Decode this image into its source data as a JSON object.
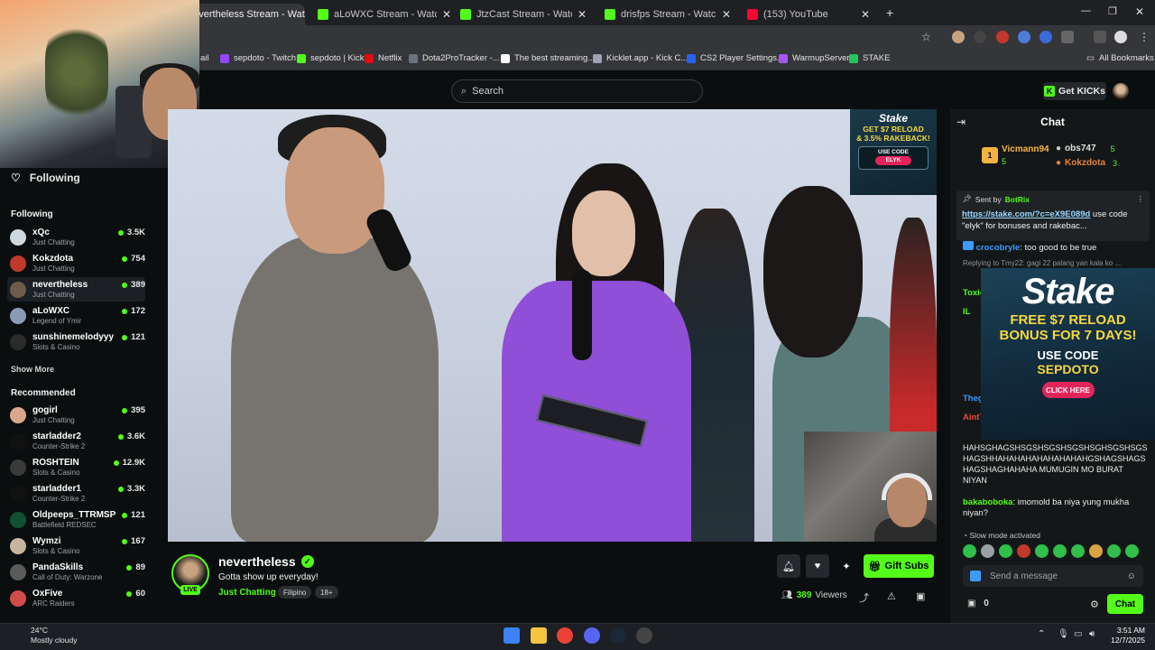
{
  "browser": {
    "tabs": [
      {
        "label": "nevertheless Stream - Watch Live on Kick",
        "active": true,
        "favicon": "kick"
      },
      {
        "label": "aLoWXC Stream - Watch Live on Kick",
        "favicon": "kick"
      },
      {
        "label": "JtzCast Stream - Watch Live on Kick",
        "favicon": "kick"
      },
      {
        "label": "drisfps Stream - Watch Live on Kick",
        "favicon": "kick"
      },
      {
        "label": "(153) YouTube",
        "favicon": "youtube"
      }
    ],
    "new_tab": "+",
    "bookmarks": [
      {
        "label": "ail",
        "color": "#3b82f6"
      },
      {
        "label": "sepdoto - Twitch",
        "color": "#9146ff"
      },
      {
        "label": "sepdoto | Kick",
        "color": "#53fc18"
      },
      {
        "label": "Netflix",
        "color": "#e50914"
      },
      {
        "label": "Dota2ProTracker -...",
        "color": "#6b7280"
      },
      {
        "label": "The best streaming...",
        "color": "#ffffff"
      },
      {
        "label": "Kicklet.app - Kick C...",
        "color": "#9ca3af"
      },
      {
        "label": "CS2 Player Settings...",
        "color": "#2563eb"
      },
      {
        "label": "WarmupServer",
        "color": "#a855f7"
      },
      {
        "label": "STAKE",
        "color": "#22c55e"
      }
    ],
    "all_bookmarks": "All Bookmarks"
  },
  "kick": {
    "search_placeholder": "Search",
    "get_kicks": "Get KICKs"
  },
  "sidebar": {
    "following_title": "Following",
    "following_header": "Following",
    "following": [
      {
        "name": "xQc",
        "category": "Just Chatting",
        "viewers": "3.5K",
        "color": "#cfd8dc"
      },
      {
        "name": "Kokzdota",
        "category": "Just Chatting",
        "viewers": "754",
        "color": "#c0392b"
      },
      {
        "name": "nevertheless",
        "category": "Just Chatting",
        "viewers": "389",
        "color": "#6d5b4b"
      },
      {
        "name": "aLoWXC",
        "category": "Legend of Ymir",
        "viewers": "172",
        "color": "#8a9bb3"
      },
      {
        "name": "sunshinemelodyyy",
        "category": "Slots & Casino",
        "viewers": "121",
        "color": "#2b2b2b"
      }
    ],
    "show_more": "Show More",
    "recommended_header": "Recommended",
    "recommended": [
      {
        "name": "gogirl",
        "category": "Just Chatting",
        "viewers": "395",
        "color": "#d9a88a"
      },
      {
        "name": "starladder2",
        "category": "Counter-Strike 2",
        "viewers": "3.6K",
        "color": "#111111"
      },
      {
        "name": "ROSHTEIN",
        "category": "Slots & Casino",
        "viewers": "12.9K",
        "color": "#3a3a3a"
      },
      {
        "name": "starladder1",
        "category": "Counter-Strike 2",
        "viewers": "3.3K",
        "color": "#111111"
      },
      {
        "name": "Oldpeeps_TTRMSP",
        "category": "Battlefield REDSEC",
        "viewers": "121",
        "color": "#0f5132"
      },
      {
        "name": "Wymzi",
        "category": "Slots & Casino",
        "viewers": "167",
        "color": "#c7b5a0"
      },
      {
        "name": "PandaSkills",
        "category": "Call of Duty: Warzone",
        "viewers": "89",
        "color": "#5a5a5a"
      },
      {
        "name": "OxFive",
        "category": "ARC Raiders",
        "viewers": "60",
        "color": "#d24b4b"
      }
    ]
  },
  "ad_small": {
    "brand": "Stake",
    "line1": "GET $7 RELOAD",
    "line2": "& 3.5% RAKEBACK!",
    "code_label": "USE CODE",
    "code": "ELYK"
  },
  "stream": {
    "name": "nevertheless",
    "live": "LIVE",
    "title": "Gotta show up everyday!",
    "category": "Just Chatting",
    "tags": [
      "Filipino",
      "18+"
    ],
    "gift_subs": "Gift Subs",
    "viewers": "389",
    "viewers_label": "Viewers"
  },
  "chat": {
    "title": "Chat",
    "gifters": [
      {
        "name": "Vicmann94",
        "count": "5",
        "color": "#f5b342"
      },
      {
        "name": "obs747",
        "count": "5",
        "color": "#e0e0e0"
      },
      {
        "name": "Kokzdota",
        "count": "3",
        "color": "#e8843a"
      }
    ],
    "pinned": {
      "sent_by": "Sent by",
      "bot": "BotRix",
      "link": "https://stake.com/?c=eX9E089d",
      "text": " use code \"elyk\" for bonuses and rakebac..."
    },
    "messages": [
      {
        "user": "crocobryle",
        "color": "#53fc18",
        "text": ": too good to be true"
      },
      {
        "user": "Toxic",
        "color": "#53fc18",
        "text": ""
      },
      {
        "user": "IL",
        "color": "#53fc18",
        "text": ""
      },
      {
        "user": "Theg",
        "color": "#3b9bff",
        "text": ""
      },
      {
        "user": "AintT",
        "color": "#e74c3c",
        "text": ""
      }
    ],
    "reply_text": "Replying to Tmy22: gagi 22 palang yan kala ko ...",
    "long_message": "HAHSGHAGSHSGSHSGSHSGSHSGHSGSHSGS HAGSHHAHAHAHAHAHAHAHAHGSHAGSHAGS HAGSHAGHAHAHA MUMUGIN MO BURAT NIYAN",
    "last_user": "bakaboboka",
    "last_user_color": "#53fc18",
    "last_text": ": imomold ba niya yung mukha niyan?",
    "slow_mode": "Slow mode activated",
    "send_placeholder": "Send a message",
    "points": "0",
    "chat_button": "Chat"
  },
  "ad_big": {
    "brand": "Stake",
    "line1": "FREE $7 RELOAD",
    "line2": "BONUS FOR 7 DAYS!",
    "line3": "USE CODE",
    "line4": "SEPDOTO",
    "button": "CLICK HERE"
  },
  "taskbar": {
    "temp": "24°C",
    "weather": "Mostly cloudy",
    "time": "3:51 AM",
    "date": "12/7/2025"
  }
}
